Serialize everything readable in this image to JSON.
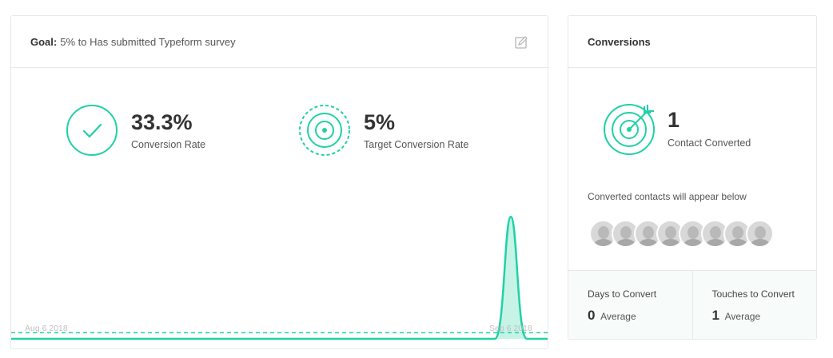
{
  "goal": {
    "prefix": "Goal:",
    "description": "5% to Has submitted Typeform survey",
    "metrics": [
      {
        "value": "33.3%",
        "label": "Conversion Rate",
        "icon": "check-circle-icon"
      },
      {
        "value": "5%",
        "label": "Target Conversion Rate",
        "icon": "target-icon"
      }
    ],
    "chart": {
      "start_label": "Aug 6 2018",
      "end_label": "Sep 6 2018"
    }
  },
  "chart_data": {
    "type": "line",
    "series": [
      {
        "values": [
          0,
          0,
          0,
          0,
          0,
          0,
          0,
          0,
          0,
          0,
          0,
          0,
          0,
          0,
          0,
          0,
          0,
          0,
          0,
          0,
          0,
          0,
          0,
          0,
          0,
          0,
          0,
          0,
          0,
          0,
          1
        ]
      }
    ],
    "target_line": 0.05,
    "xlabel": "",
    "ylabel": "",
    "ylim": [
      0,
      1.1
    ]
  },
  "conversions": {
    "title": "Conversions",
    "count": "1",
    "count_label": "Contact Converted",
    "appear_text": "Converted contacts will appear below",
    "avatar_count": 8,
    "stats": [
      {
        "label": "Days to Convert",
        "value": "0",
        "unit": "Average"
      },
      {
        "label": "Touches to Convert",
        "value": "1",
        "unit": "Average"
      }
    ]
  },
  "colors": {
    "accent": "#1fd1a6",
    "accent_fill": "#c7f3e7",
    "grid_text": "#bfbfbf"
  }
}
